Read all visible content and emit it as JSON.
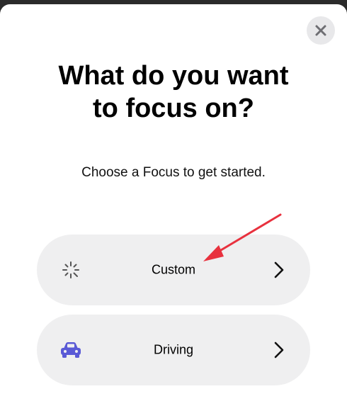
{
  "sheet": {
    "title_line1": "What do you want",
    "title_line2": "to focus on?",
    "subtitle": "Choose a Focus to get started.",
    "close_icon": "close-icon"
  },
  "options": [
    {
      "label": "Custom",
      "icon": "sparkle-icon",
      "icon_color": "#555555"
    },
    {
      "label": "Driving",
      "icon": "car-icon",
      "icon_color": "#5a5ad6"
    }
  ],
  "annotation": {
    "arrow_color": "#e8313e"
  }
}
